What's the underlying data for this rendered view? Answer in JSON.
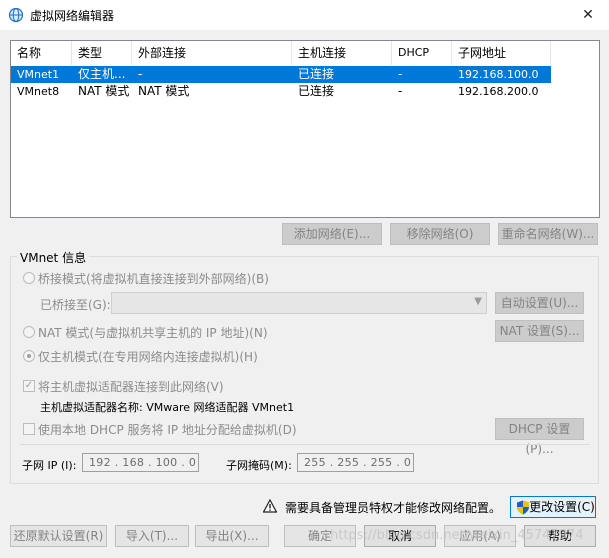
{
  "window": {
    "title": "虚拟网络编辑器",
    "close_glyph": "✕"
  },
  "table": {
    "columns": [
      "名称",
      "类型",
      "外部连接",
      "主机连接",
      "DHCP",
      "子网地址"
    ],
    "rows": [
      {
        "name": "VMnet1",
        "type": "仅主机...",
        "external": "-",
        "host": "已连接",
        "dhcp": "-",
        "subnet": "192.168.100.0",
        "selected": true
      },
      {
        "name": "VMnet8",
        "type": "NAT 模式",
        "external": "NAT 模式",
        "host": "已连接",
        "dhcp": "-",
        "subnet": "192.168.200.0",
        "selected": false
      }
    ]
  },
  "network_buttons": {
    "add": "添加网络(E)...",
    "remove": "移除网络(O)",
    "rename": "重命名网络(W)..."
  },
  "vmnet_info": {
    "group_label": "VMnet 信息",
    "bridge_mode": "桥接模式(将虚拟机直接连接到外部网络)(B)",
    "bridged_to_label": "已桥接至(G):",
    "bridged_to_value": "",
    "auto_settings": "自动设置(U)...",
    "nat_mode": "NAT 模式(与虚拟机共享主机的 IP 地址)(N)",
    "nat_settings": "NAT 设置(S)...",
    "host_only_mode": "仅主机模式(在专用网络内连接虚拟机)(H)",
    "connect_adapter": "将主机虚拟适配器连接到此网络(V)",
    "adapter_name_label": "主机虚拟适配器名称: VMware 网络适配器 VMnet1",
    "use_dhcp": "使用本地 DHCP 服务将 IP 地址分配给虚拟机(D)",
    "dhcp_settings": "DHCP 设置(P)...",
    "subnet_ip_label": "子网 IP (I):",
    "subnet_ip_value": "192 . 168 . 100 .  0",
    "subnet_mask_label": "子网掩码(M):",
    "subnet_mask_value": "255 . 255 . 255 .  0",
    "selected_mode": "host_only",
    "connect_adapter_checked": true,
    "use_dhcp_checked": false
  },
  "admin_notice": {
    "text": "需要具备管理员特权才能修改网络配置。",
    "change_settings": "更改设置(C)"
  },
  "bottom_buttons": {
    "restore_defaults": "还原默认设置(R)",
    "import": "导入(T)...",
    "export": "导出(X)...",
    "ok": "确定",
    "cancel": "取消",
    "apply": "应用(A)",
    "help": "帮助"
  },
  "watermark": "https://blog.csdn.net/weixin_45747974",
  "colors": {
    "selection": "#0078d7",
    "warning": "#f5c518",
    "shield_blue": "#1f5fbf",
    "shield_yellow": "#f2c200"
  }
}
